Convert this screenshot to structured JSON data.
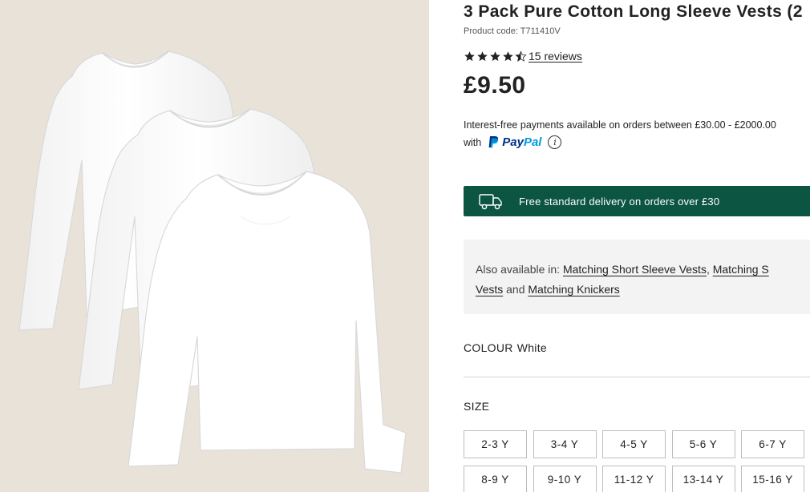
{
  "product": {
    "title": "3 Pack Pure Cotton Long Sleeve Vests (2",
    "product_code": "Product code: T711410V",
    "rating": {
      "value": 4.5,
      "max": 5,
      "reviews_label": "15 reviews"
    },
    "price": "£9.50"
  },
  "payment": {
    "line1": "Interest-free payments available on orders between £30.00 - £2000.00",
    "line2_prefix": "with",
    "paypal_part1": "Pay",
    "paypal_part2": "Pal",
    "info_glyph": "i",
    "icons": [
      "paypal-icon",
      "info-icon"
    ]
  },
  "delivery": {
    "text": "Free standard delivery on orders over £30",
    "icon": "truck-icon",
    "bg_color": "#0c5542"
  },
  "also_available": {
    "prefix": "Also available in:",
    "link1": "Matching Short Sleeve Vests",
    "sep1": ",",
    "link2_part1": "Matching S",
    "link2_part2": "Vests",
    "conj": "and",
    "link3": "Matching Knickers"
  },
  "colour": {
    "label": "COLOUR",
    "value": "White"
  },
  "size": {
    "label": "SIZE",
    "options": [
      "2-3 Y",
      "3-4 Y",
      "4-5 Y",
      "5-6 Y",
      "6-7 Y",
      "8-9 Y",
      "9-10 Y",
      "11-12 Y",
      "13-14 Y",
      "15-16 Y"
    ]
  },
  "gallery": {
    "image": "three-white-long-sleeve-vests",
    "bg_color": "#e9e2d9"
  }
}
